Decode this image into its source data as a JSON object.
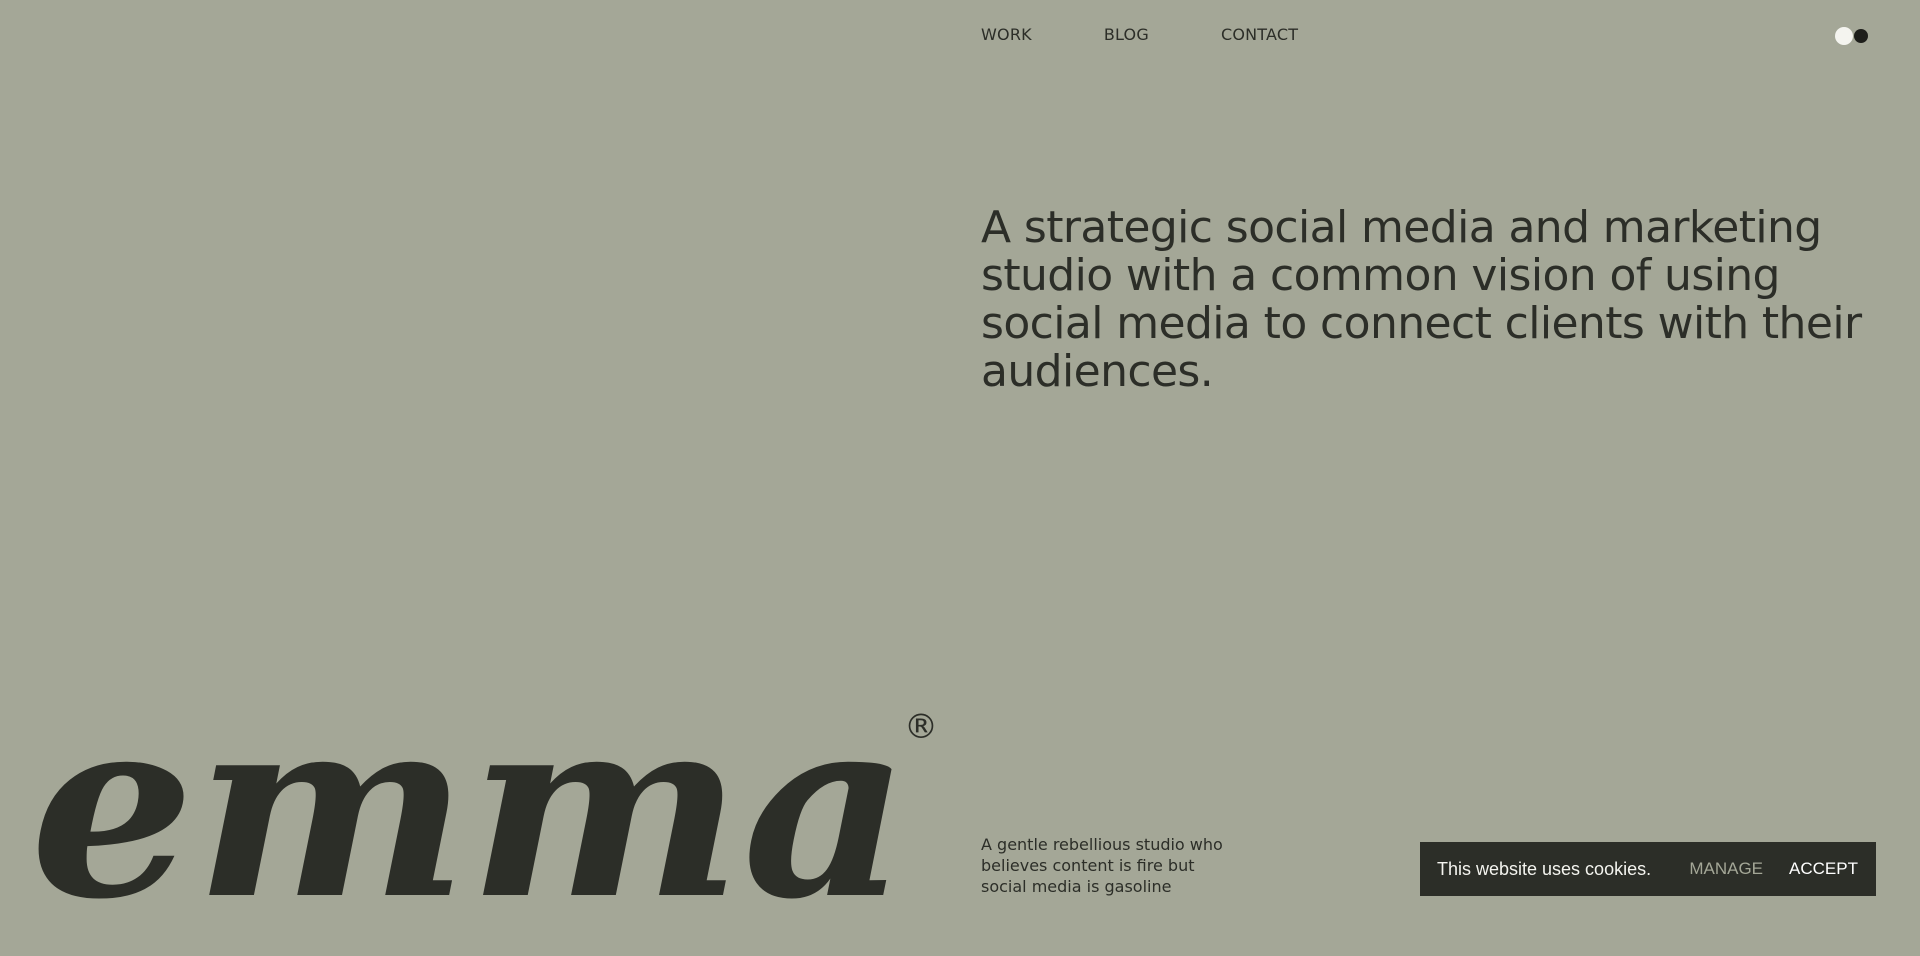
{
  "nav": {
    "items": [
      {
        "label": "WORK"
      },
      {
        "label": "BLOG"
      },
      {
        "label": "CONTACT"
      }
    ]
  },
  "theme_toggle": {
    "icon": "theme-toggle-icon",
    "colors": [
      "#f4f4ef",
      "#1e1f1b"
    ]
  },
  "hero": {
    "headline": "A strategic social media and marketing studio with a common vision of using social media to connect clients with their audiences."
  },
  "brand": {
    "logo_text": "emma",
    "registered_mark": "®"
  },
  "tagline": "A gentle rebellious studio who believes content is fire but social media is gasoline",
  "cookie_banner": {
    "message": "This website uses cookies.",
    "manage_label": "MANAGE",
    "accept_label": "ACCEPT"
  },
  "colors": {
    "background": "#a4a797",
    "text": "#2c2e28",
    "banner_bg": "#2c2e28"
  }
}
